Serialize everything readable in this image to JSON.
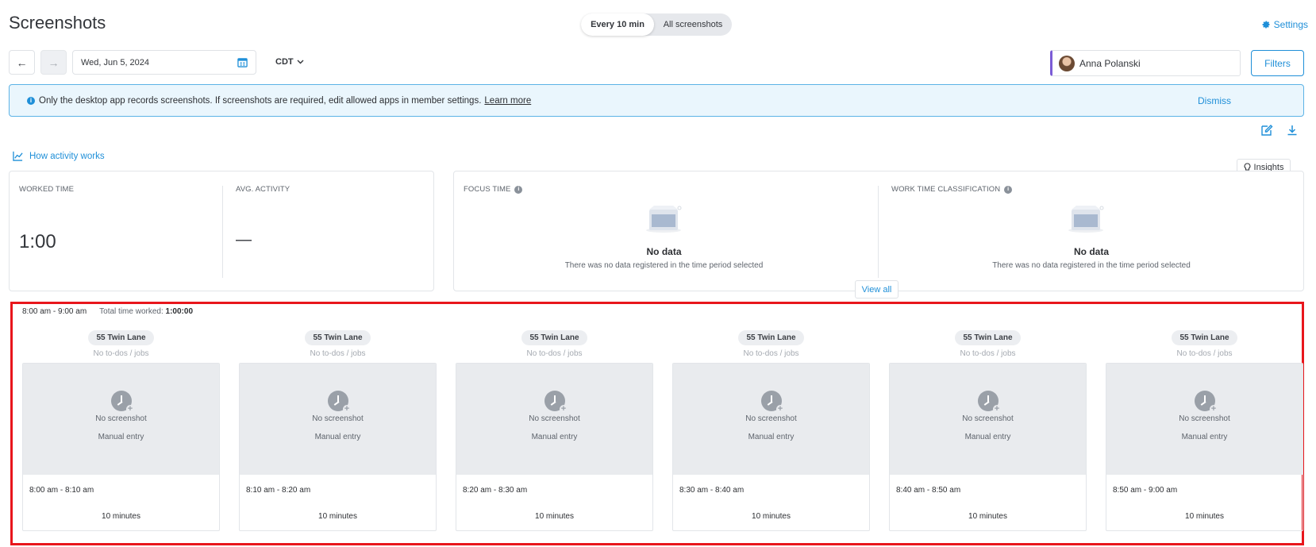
{
  "page": {
    "title": "Screenshots"
  },
  "view_toggle": {
    "active": "Every 10 min",
    "inactive": "All screenshots"
  },
  "settings": {
    "label": "Settings",
    "icon": "gear-icon"
  },
  "toolbar": {
    "prev_icon": "arrow-left-icon",
    "next_icon": "arrow-right-icon",
    "date": "Wed, Jun 5, 2024",
    "timezone": "CDT",
    "member": "Anna Polanski",
    "filters": "Filters"
  },
  "banner": {
    "message": "Only the desktop app records screenshots. If screenshots are required, edit allowed apps in member settings.",
    "link": "Learn more",
    "dismiss": "Dismiss"
  },
  "how_activity": {
    "label": "How activity works"
  },
  "insights": {
    "label": "Insights"
  },
  "stats": {
    "worked_time": {
      "label": "WORKED TIME",
      "value": "1:00"
    },
    "avg_activity": {
      "label": "AVG. ACTIVITY",
      "value": "—"
    }
  },
  "focus": {
    "label": "FOCUS TIME",
    "empty_title": "No data",
    "empty_sub": "There was no data registered in the time period selected"
  },
  "classification": {
    "label": "WORK TIME CLASSIFICATION",
    "empty_title": "No data",
    "empty_sub": "There was no data registered in the time period selected"
  },
  "view_all": "View all",
  "hour_block": {
    "range": "8:00 am - 9:00 am",
    "total_label": "Total time worked:",
    "total_value": "1:00:00",
    "slots": [
      {
        "project": "55 Twin Lane",
        "todos": "No to-dos / jobs",
        "no_shot": "No screenshot",
        "entry": "Manual entry",
        "range": "8:00 am - 8:10 am",
        "duration": "10 minutes"
      },
      {
        "project": "55 Twin Lane",
        "todos": "No to-dos / jobs",
        "no_shot": "No screenshot",
        "entry": "Manual entry",
        "range": "8:10 am - 8:20 am",
        "duration": "10 minutes"
      },
      {
        "project": "55 Twin Lane",
        "todos": "No to-dos / jobs",
        "no_shot": "No screenshot",
        "entry": "Manual entry",
        "range": "8:20 am - 8:30 am",
        "duration": "10 minutes"
      },
      {
        "project": "55 Twin Lane",
        "todos": "No to-dos / jobs",
        "no_shot": "No screenshot",
        "entry": "Manual entry",
        "range": "8:30 am - 8:40 am",
        "duration": "10 minutes"
      },
      {
        "project": "55 Twin Lane",
        "todos": "No to-dos / jobs",
        "no_shot": "No screenshot",
        "entry": "Manual entry",
        "range": "8:40 am - 8:50 am",
        "duration": "10 minutes"
      },
      {
        "project": "55 Twin Lane",
        "todos": "No to-dos / jobs",
        "no_shot": "No screenshot",
        "entry": "Manual entry",
        "range": "8:50 am - 9:00 am",
        "duration": "10 minutes"
      }
    ]
  },
  "colors": {
    "accent": "#1f8fd8",
    "highlight_border": "#e8161c",
    "member_accent": "#7b5cd6"
  }
}
